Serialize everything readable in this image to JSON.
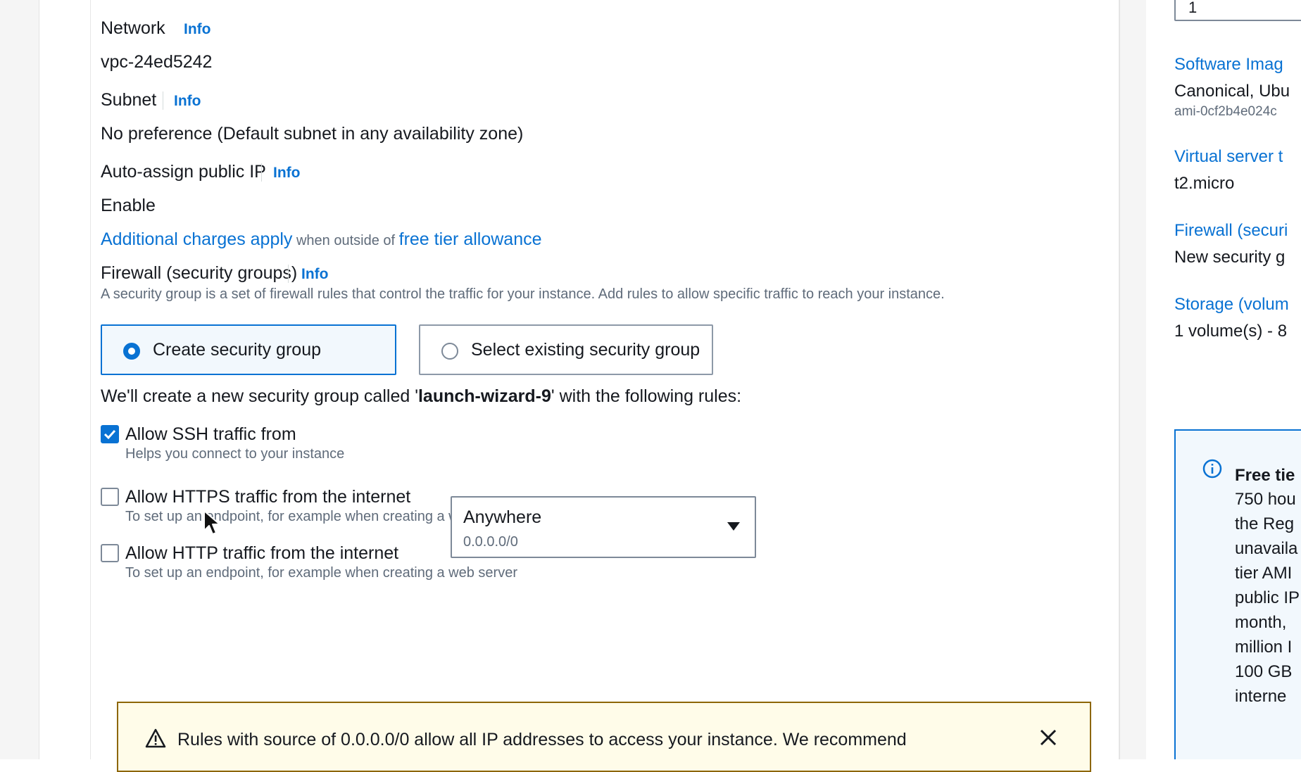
{
  "network": {
    "label": "Network",
    "info": "Info",
    "value": "vpc-24ed5242"
  },
  "subnet": {
    "label": "Subnet",
    "info": "Info",
    "value": "No preference (Default subnet in any availability zone)"
  },
  "auto_assign_ip": {
    "label": "Auto-assign public IP",
    "info": "Info",
    "value": "Enable"
  },
  "charges_note": {
    "link1": "Additional charges apply",
    "middle": " when outside of ",
    "link2": "free tier allowance"
  },
  "firewall": {
    "label": "Firewall (security groups)",
    "info": "Info",
    "description": "A security group is a set of firewall rules that control the traffic for your instance. Add rules to allow specific traffic to reach your instance.",
    "options": [
      {
        "label": "Create security group",
        "selected": true
      },
      {
        "label": "Select existing security group",
        "selected": false
      }
    ]
  },
  "rules_intro": {
    "prefix": "We'll create a new security group called '",
    "name": "launch-wizard-9",
    "suffix": "' with the following rules:"
  },
  "rules": [
    {
      "label": "Allow SSH traffic from",
      "help": "Helps you connect to your instance",
      "checked": true
    },
    {
      "label": "Allow HTTPS traffic from the internet",
      "help": "To set up an endpoint, for example when creating a web server",
      "checked": false
    },
    {
      "label": "Allow HTTP traffic from the internet",
      "help": "To set up an endpoint, for example when creating a web server",
      "checked": false
    }
  ],
  "ssh_source": {
    "value": "Anywhere",
    "cidr": "0.0.0.0/0"
  },
  "warning": {
    "message": "Rules with source of 0.0.0.0/0 allow all IP addresses to access your instance. We recommend"
  },
  "summary": {
    "top_input_value": "1",
    "software_image_label": "Software Imag",
    "software_image_value": "Canonical, Ubu",
    "ami_id": "ami-0cf2b4e024c",
    "virtual_server_label": "Virtual server t",
    "virtual_server_value": "t2.micro",
    "firewall_label": "Firewall (securi",
    "firewall_value": "New security g",
    "storage_label": "Storage (volum",
    "storage_value": "1 volume(s) - 8",
    "free_tier": {
      "title": "Free tie",
      "lines": [
        "750 hou",
        "the Reg",
        "unavaila",
        "tier AMI",
        "public IP",
        "month, ",
        "million I",
        "100 GB",
        "interne"
      ]
    }
  },
  "colors": {
    "link": "#0972d3",
    "selected_bg": "#f2f8fd",
    "warning_border": "#8d6605",
    "warning_bg": "#fffce9"
  }
}
